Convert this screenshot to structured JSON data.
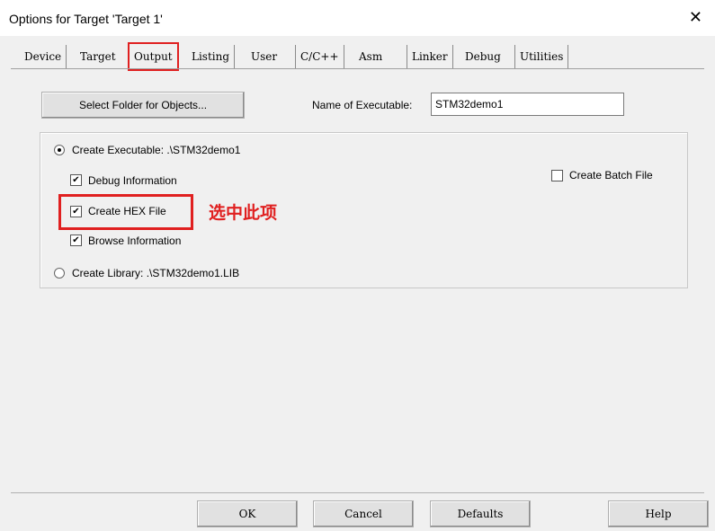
{
  "window": {
    "title": "Options for Target 'Target 1'",
    "close_glyph": "✕"
  },
  "tabs": [
    {
      "label": "Device"
    },
    {
      "label": "Target"
    },
    {
      "label": "Output"
    },
    {
      "label": "Listing"
    },
    {
      "label": "User"
    },
    {
      "label": "C/C++"
    },
    {
      "label": "Asm"
    },
    {
      "label": "Linker"
    },
    {
      "label": "Debug"
    },
    {
      "label": "Utilities"
    }
  ],
  "active_tab": "Output",
  "output": {
    "select_folder_label": "Select Folder for Objects...",
    "name_exec_label": "Name of Executable:",
    "name_exec_value": "STM32demo1",
    "create_executable_label": "Create Executable:  .\\STM32demo1",
    "debug_info_label": "Debug Information",
    "create_hex_label": "Create HEX File",
    "browse_info_label": "Browse Information",
    "create_library_label": "Create Library:  .\\STM32demo1.LIB",
    "create_batch_label": "Create Batch File",
    "check_mark": "✔"
  },
  "annotation": {
    "text": "选中此项",
    "color": "#e02020"
  },
  "buttons": {
    "ok": "OK",
    "cancel": "Cancel",
    "defaults": "Defaults",
    "help": "Help"
  }
}
